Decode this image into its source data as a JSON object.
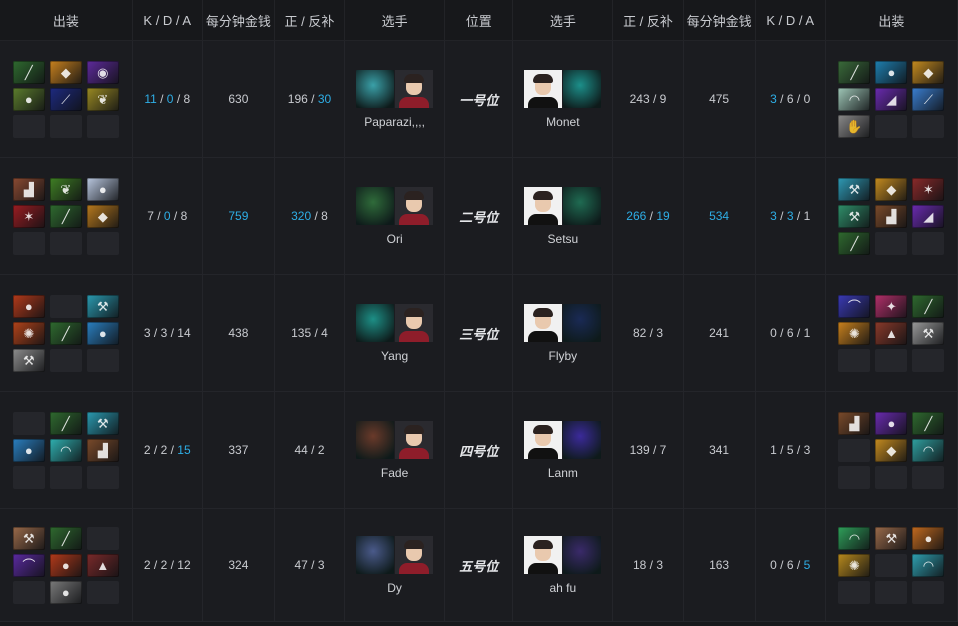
{
  "headers": {
    "left": [
      "出装",
      "K / D / A",
      "每分钟金钱",
      "正 / 反补",
      "选手"
    ],
    "position": "位置",
    "right": [
      "选手",
      "正 / 反补",
      "每分钟金钱",
      "K / D / A",
      "出装"
    ]
  },
  "accent_color": "#2eaee6",
  "rows": [
    {
      "position": "一号位",
      "left": {
        "items": [
          [
            "#2f6a2f",
            "wand"
          ],
          [
            "#c7811e",
            "mask"
          ],
          [
            "#5e2a9c",
            "eye"
          ],
          [
            "#5c7d2d",
            "bread"
          ],
          [
            "#1d2a80",
            "staff"
          ],
          [
            "#9a8a23",
            "leaf"
          ],
          null,
          null,
          null
        ],
        "kda": [
          "11",
          "0",
          "8"
        ],
        "kda_hl": [
          true,
          true,
          false
        ],
        "gpm": "630",
        "gpm_hl": false,
        "lh": [
          "196",
          "30"
        ],
        "lh_hl": [
          false,
          true
        ],
        "player": "Paparazi,,,,",
        "hero_color": "#3aa0a8",
        "face": "red"
      },
      "right": {
        "items": [
          [
            "#3a6b3a",
            "wand"
          ],
          [
            "#1e7fb0",
            "orb"
          ],
          [
            "#c58b1f",
            "mask"
          ],
          [
            "#9fc7b7",
            "swirl"
          ],
          [
            "#6a2bb0",
            "blade"
          ],
          [
            "#3a7ed0",
            "staff"
          ],
          [
            "#8a8a8a",
            "hand"
          ],
          null,
          null
        ],
        "kda": [
          "3",
          "6",
          "0"
        ],
        "kda_hl": [
          true,
          false,
          false
        ],
        "gpm": "475",
        "gpm_hl": false,
        "lh": [
          "243",
          "9"
        ],
        "lh_hl": [
          false,
          false
        ],
        "player": "Monet",
        "hero_color": "#1c8f8a",
        "face": "white"
      }
    },
    {
      "position": "二号位",
      "left": {
        "items": [
          [
            "#8a4a32",
            "boot"
          ],
          [
            "#3f7f24",
            "leaf"
          ],
          [
            "#b9c7df",
            "orb"
          ],
          [
            "#9a1d22",
            "claw"
          ],
          [
            "#2f6a2f",
            "wand"
          ],
          [
            "#b7791d",
            "mask"
          ],
          null,
          null,
          null
        ],
        "kda": [
          "7",
          "0",
          "8"
        ],
        "kda_hl": [
          false,
          true,
          false
        ],
        "gpm": "759",
        "gpm_hl": true,
        "lh": [
          "320",
          "8"
        ],
        "lh_hl": [
          true,
          false
        ],
        "player": "Ori",
        "hero_color": "#2f6b3a",
        "face": "red"
      },
      "right": {
        "items": [
          [
            "#2e9ab5",
            "axe"
          ],
          [
            "#c58b1f",
            "mask"
          ],
          [
            "#8a2a2a",
            "claw"
          ],
          [
            "#2f8f6a",
            "axe"
          ],
          [
            "#7a4a2a",
            "boot"
          ],
          [
            "#6a2bb0",
            "blade"
          ],
          [
            "#2f6a2f",
            "wand"
          ],
          null,
          null
        ],
        "kda": [
          "3",
          "3",
          "1"
        ],
        "kda_hl": [
          true,
          true,
          false
        ],
        "gpm": "534",
        "gpm_hl": true,
        "lh": [
          "266",
          "19"
        ],
        "lh_hl": [
          true,
          true
        ],
        "player": "Setsu",
        "hero_color": "#1f6b52",
        "face": "white"
      }
    },
    {
      "position": "三号位",
      "left": {
        "items": [
          [
            "#b33a1a",
            "orb"
          ],
          null,
          [
            "#2a9ab0",
            "axe"
          ],
          [
            "#b2431a",
            "gear"
          ],
          [
            "#2f6a2f",
            "wand"
          ],
          [
            "#2a7fc0",
            "orb"
          ],
          [
            "#8d8d8d",
            "axe"
          ],
          null,
          null
        ],
        "kda": [
          "3",
          "3",
          "14"
        ],
        "kda_hl": [
          false,
          false,
          false
        ],
        "gpm": "438",
        "gpm_hl": false,
        "lh": [
          "135",
          "4"
        ],
        "lh_hl": [
          false,
          false
        ],
        "player": "Yang",
        "hero_color": "#1d8f86",
        "face": "red"
      },
      "right": {
        "items": [
          [
            "#3a3ab5",
            "bow"
          ],
          [
            "#b3306a",
            "star"
          ],
          [
            "#2f6a2f",
            "wand"
          ],
          [
            "#c9811d",
            "gear"
          ],
          [
            "#8a3a2a",
            "helm"
          ],
          [
            "#9a9a9a",
            "axe"
          ],
          null,
          null,
          null
        ],
        "kda": [
          "0",
          "6",
          "1"
        ],
        "kda_hl": [
          false,
          false,
          false
        ],
        "gpm": "241",
        "gpm_hl": false,
        "lh": [
          "82",
          "3"
        ],
        "lh_hl": [
          false,
          false
        ],
        "player": "Flyby",
        "hero_color": "#1a2a55",
        "face": "white"
      }
    },
    {
      "position": "四号位",
      "left": {
        "items": [
          null,
          [
            "#2f6a2f",
            "wand"
          ],
          [
            "#2a9ab0",
            "axe"
          ],
          [
            "#2a7fc0",
            "orb"
          ],
          [
            "#2fb0b0",
            "swirl"
          ],
          [
            "#7a4a2a",
            "boot"
          ],
          null,
          null,
          null
        ],
        "kda": [
          "2",
          "2",
          "15"
        ],
        "kda_hl": [
          false,
          false,
          true
        ],
        "gpm": "337",
        "gpm_hl": false,
        "lh": [
          "44",
          "2"
        ],
        "lh_hl": [
          false,
          false
        ],
        "player": "Fade",
        "hero_color": "#6a3a2a",
        "face": "red"
      },
      "right": {
        "items": [
          [
            "#7a4a2a",
            "boot"
          ],
          [
            "#6a2bb0",
            "orb"
          ],
          [
            "#2f6a2f",
            "wand"
          ],
          null,
          [
            "#c58b1f",
            "mask"
          ],
          [
            "#2fa0a0",
            "swirl"
          ],
          null,
          null,
          null
        ],
        "kda": [
          "1",
          "5",
          "3"
        ],
        "kda_hl": [
          false,
          false,
          false
        ],
        "gpm": "341",
        "gpm_hl": false,
        "lh": [
          "139",
          "7"
        ],
        "lh_hl": [
          false,
          false
        ],
        "player": "Lanm",
        "hero_color": "#3b2a9a",
        "face": "white"
      }
    },
    {
      "position": "五号位",
      "left": {
        "items": [
          [
            "#9a6a4a",
            "axe"
          ],
          [
            "#2f6a2f",
            "wand"
          ],
          null,
          [
            "#5a2aa0",
            "bow"
          ],
          [
            "#b33a1a",
            "orb"
          ],
          [
            "#7a2a2a",
            "helm"
          ],
          null,
          [
            "#7a7a7a",
            "ball"
          ],
          null
        ],
        "kda": [
          "2",
          "2",
          "12"
        ],
        "kda_hl": [
          false,
          false,
          false
        ],
        "gpm": "324",
        "gpm_hl": false,
        "lh": [
          "47",
          "3"
        ],
        "lh_hl": [
          false,
          false
        ],
        "player": "Dy",
        "hero_color": "#4a5a8a",
        "face": "red"
      },
      "right": {
        "items": [
          [
            "#2fa05a",
            "swirl"
          ],
          [
            "#9a6a4a",
            "axe"
          ],
          [
            "#c26a1f",
            "orb"
          ],
          [
            "#b88a1d",
            "gear"
          ],
          null,
          [
            "#2fa0b0",
            "swirl"
          ],
          null,
          null,
          null
        ],
        "kda": [
          "0",
          "6",
          "5"
        ],
        "kda_hl": [
          false,
          false,
          true
        ],
        "gpm": "163",
        "gpm_hl": false,
        "lh": [
          "18",
          "3"
        ],
        "lh_hl": [
          false,
          false
        ],
        "player": "ah fu",
        "hero_color": "#3a2a6a",
        "face": "white"
      }
    }
  ]
}
